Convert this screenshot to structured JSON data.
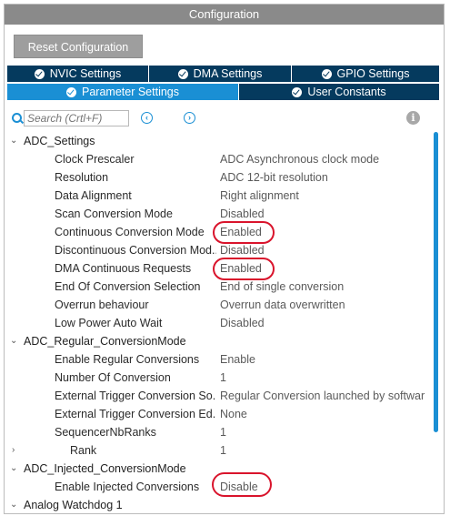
{
  "window": {
    "title": "Configuration"
  },
  "reset_button": "Reset Configuration",
  "tabs_top": [
    {
      "label": "NVIC Settings"
    },
    {
      "label": "DMA Settings"
    },
    {
      "label": "GPIO Settings"
    }
  ],
  "tabs_bottom": [
    {
      "label": "Parameter Settings",
      "active": true
    },
    {
      "label": "User Constants",
      "active": false
    }
  ],
  "search": {
    "placeholder": "Search (Crtl+F)",
    "prev": "‹",
    "next": "›"
  },
  "info": "i",
  "tree": {
    "adc_settings": {
      "label": "ADC_Settings",
      "params": [
        {
          "name": "Clock Prescaler",
          "value": "ADC Asynchronous clock mode"
        },
        {
          "name": "Resolution",
          "value": "ADC 12-bit resolution"
        },
        {
          "name": "Data Alignment",
          "value": "Right alignment"
        },
        {
          "name": "Scan Conversion Mode",
          "value": "Disabled"
        },
        {
          "name": "Continuous Conversion Mode",
          "value": "Enabled"
        },
        {
          "name": "Discontinuous Conversion Mod...",
          "value": "Disabled"
        },
        {
          "name": "DMA Continuous Requests",
          "value": "Enabled"
        },
        {
          "name": "End Of Conversion Selection",
          "value": "End of single conversion"
        },
        {
          "name": "Overrun behaviour",
          "value": "Overrun data overwritten"
        },
        {
          "name": "Low Power Auto Wait",
          "value": "Disabled"
        }
      ]
    },
    "adc_regular": {
      "label": "ADC_Regular_ConversionMode",
      "params": [
        {
          "name": "Enable Regular Conversions",
          "value": "Enable"
        },
        {
          "name": "Number Of Conversion",
          "value": "1"
        },
        {
          "name": "External Trigger Conversion So...",
          "value": "Regular Conversion launched by softwar..."
        },
        {
          "name": "External Trigger Conversion Ed...",
          "value": "None"
        },
        {
          "name": "SequencerNbRanks",
          "value": "1"
        }
      ],
      "rank": {
        "name": "Rank",
        "value": "1"
      }
    },
    "adc_injected": {
      "label": "ADC_Injected_ConversionMode",
      "params": [
        {
          "name": "Enable Injected Conversions",
          "value": "Disable"
        }
      ]
    },
    "analog_watchdog": {
      "label": "Analog Watchdog 1"
    }
  },
  "colors": {
    "titlebar": "#8a8a8a",
    "tab_dark": "#053a5e",
    "tab_active": "#1a8fd4",
    "highlight_circle": "#d9142c"
  },
  "icons": {
    "expand": "⌄",
    "collapse": "›"
  }
}
